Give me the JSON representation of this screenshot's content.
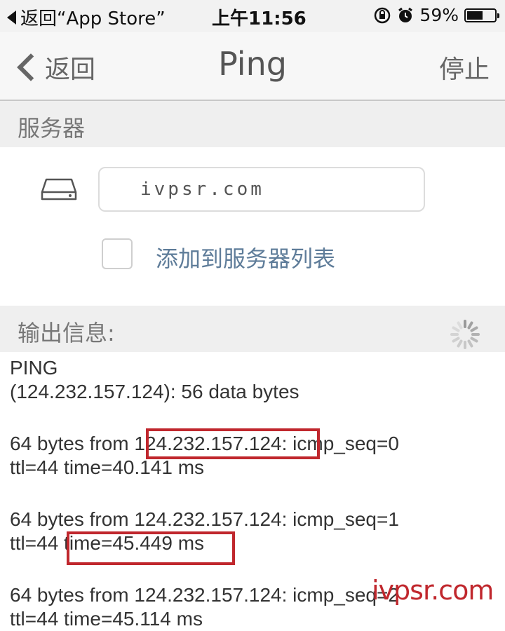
{
  "status_bar": {
    "back_to_app": "返回“App Store”",
    "time": "上午11:56",
    "battery_percent": "59%",
    "battery_level": 0.59,
    "icons": [
      "lock-rotation-icon",
      "alarm-icon",
      "battery-icon"
    ]
  },
  "nav": {
    "back_label": "返回",
    "title": "Ping",
    "stop_label": "停止"
  },
  "server_section": {
    "header": "服务器",
    "input_value": "ivpsr.com",
    "add_to_list_label": "添加到服务器列表",
    "add_to_list_checked": false
  },
  "output_section": {
    "header": "输出信息:",
    "lines": [
      "PING",
      "(124.232.157.124): 56 data bytes",
      "",
      "64 bytes from 124.232.157.124: icmp_seq=0",
      "ttl=44 time=40.141 ms",
      "",
      "64 bytes from 124.232.157.124: icmp_seq=1",
      "ttl=44 time=45.449 ms",
      "",
      "64 bytes from 124.232.157.124: icmp_seq=2",
      "ttl=44 time=45.114 ms"
    ]
  },
  "watermark": "ivpsr.com",
  "colors": {
    "highlight_box": "#c0272d",
    "link_text": "#5e7c99",
    "section_bg": "#efefef"
  }
}
